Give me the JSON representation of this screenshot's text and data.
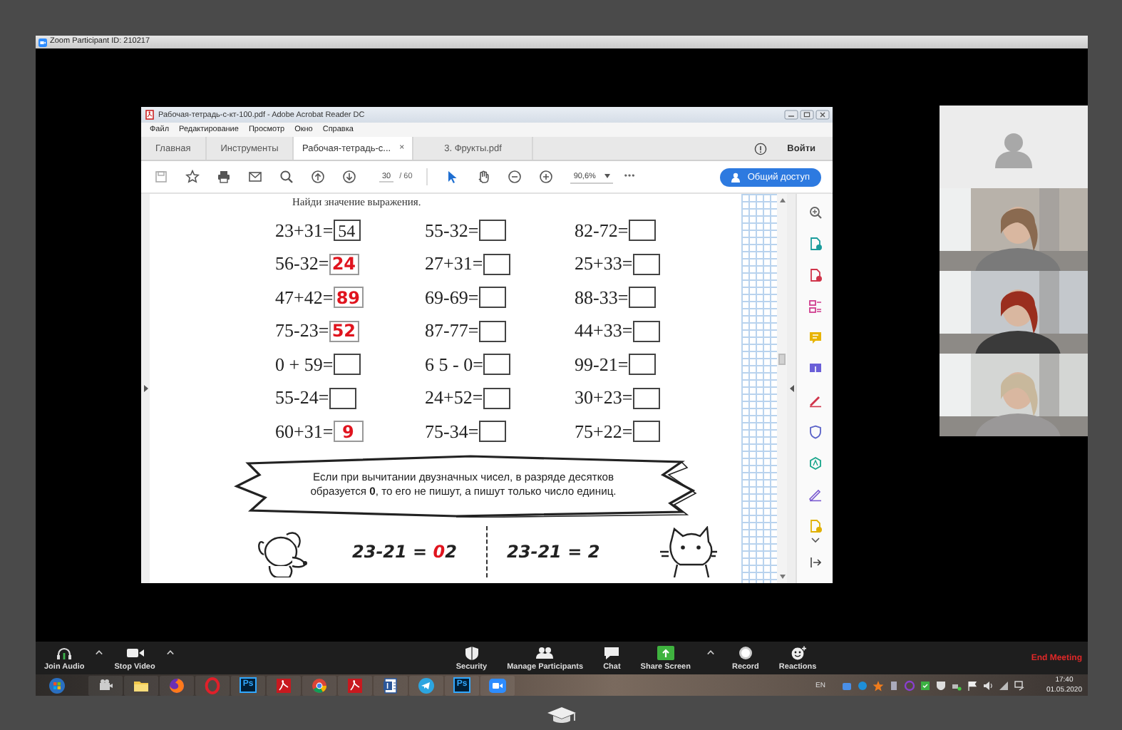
{
  "zoom_window": {
    "title": "Zoom Participant ID: 210217"
  },
  "acrobat": {
    "title": "Рабочая-тетрадь-с-кт-100.pdf - Adobe Acrobat Reader DC",
    "menu": [
      "Файл",
      "Редактирование",
      "Просмотр",
      "Окно",
      "Справка"
    ],
    "tabs": [
      {
        "label": "Главная",
        "kind": "nav",
        "selected": false
      },
      {
        "label": "Инструменты",
        "kind": "nav",
        "selected": false
      },
      {
        "label": "Рабочая-тетрадь-с...",
        "kind": "doc",
        "selected": true,
        "close": "×"
      },
      {
        "label": "3. Фрукты.pdf",
        "kind": "doc",
        "selected": false
      }
    ],
    "sign_in": "Войти",
    "page_number": "30",
    "page_total": "/ 60",
    "zoom": "90,6%",
    "more": "•••",
    "share": "Общий доступ"
  },
  "worksheet": {
    "heading": "Найди значение выражения.",
    "exercises": [
      {
        "expression": "23+31=",
        "kind": "printed",
        "answer": "54"
      },
      {
        "expression": "55-32=",
        "kind": "empty"
      },
      {
        "expression": "82-72=",
        "kind": "empty"
      },
      {
        "expression": "56-32=",
        "kind": "handwritten",
        "answer": "24"
      },
      {
        "expression": "27+31=",
        "kind": "empty"
      },
      {
        "expression": "25+33=",
        "kind": "empty"
      },
      {
        "expression": "47+42=",
        "kind": "handwritten",
        "answer": "89"
      },
      {
        "expression": "69-69=",
        "kind": "empty"
      },
      {
        "expression": "88-33=",
        "kind": "empty"
      },
      {
        "expression": "75-23=",
        "kind": "handwritten",
        "answer": "52"
      },
      {
        "expression": "87-77=",
        "kind": "empty"
      },
      {
        "expression": "44+33=",
        "kind": "empty"
      },
      {
        "expression": "0 + 59=",
        "kind": "empty"
      },
      {
        "expression": "6 5 - 0=",
        "kind": "empty"
      },
      {
        "expression": "99-21=",
        "kind": "empty"
      },
      {
        "expression": "55-24=",
        "kind": "empty"
      },
      {
        "expression": "24+52=",
        "kind": "empty"
      },
      {
        "expression": "30+23=",
        "kind": "empty"
      },
      {
        "expression": "60+31=",
        "kind": "handwritten",
        "answer": "9"
      },
      {
        "expression": "75-34=",
        "kind": "empty"
      },
      {
        "expression": "75+22=",
        "kind": "empty"
      }
    ],
    "rule": "Если при вычитании двузначных чисел, в разряде десятков образуется **0**, то его не пишут, а пишут только число единиц.",
    "examples": [
      {
        "expression": "23-21 =",
        "struck": "0",
        "result": "2"
      },
      {
        "expression": "23-21 =",
        "result": "2"
      }
    ]
  },
  "participants": [
    {
      "kind": "avatar"
    },
    {
      "kind": "picture"
    },
    {
      "kind": "picture"
    },
    {
      "kind": "picture"
    }
  ],
  "toolbar": {
    "left": [
      {
        "label": "Join Audio",
        "kind": "audio",
        "menu": true
      },
      {
        "label": "Stop Video",
        "kind": "video",
        "menu": true
      }
    ],
    "center": [
      {
        "label": "Security",
        "kind": "security",
        "menu": false
      },
      {
        "label": "Manage Participants",
        "kind": "participants",
        "menu": false
      },
      {
        "label": "Chat",
        "kind": "chat",
        "menu": false
      },
      {
        "label": "Share Screen",
        "kind": "share",
        "menu": true
      },
      {
        "label": "Record",
        "kind": "record",
        "menu": false
      },
      {
        "label": "Reactions",
        "kind": "reactions",
        "menu": false
      }
    ],
    "end": "End Meeting"
  },
  "taskbar": {
    "apps": [
      {
        "kind": "start"
      },
      {
        "kind": "media"
      },
      {
        "kind": "folder"
      },
      {
        "kind": "firefox"
      },
      {
        "kind": "opera"
      },
      {
        "kind": "photoshop",
        "label": "Ps"
      },
      {
        "kind": "acrobat"
      },
      {
        "kind": "chrome"
      },
      {
        "kind": "acrobat"
      },
      {
        "kind": "word"
      },
      {
        "kind": "telegram"
      },
      {
        "kind": "photoshop",
        "label": "Ps"
      },
      {
        "kind": "zoom"
      }
    ],
    "language": "EN",
    "time": "17:40",
    "date": "01.05.2020"
  }
}
